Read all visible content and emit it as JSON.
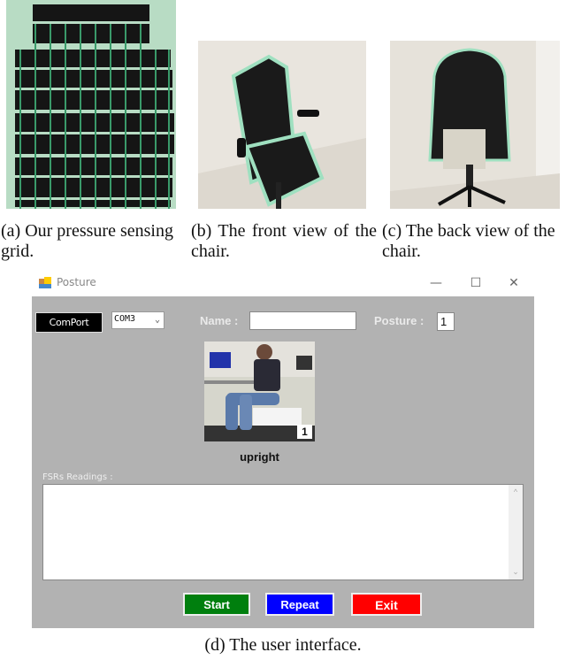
{
  "figures": {
    "a": {
      "caption": "(a) Our pressure sensing grid."
    },
    "b": {
      "caption": "(b) The front view of the chair."
    },
    "c": {
      "caption": "(c) The back view of the chair."
    },
    "d": {
      "caption": "(d) The user interface."
    }
  },
  "window": {
    "title": "Posture",
    "icon": "app-window-icon",
    "controls": {
      "minimize": "—",
      "maximize": "☐",
      "close": "✕"
    }
  },
  "toolbar": {
    "comport_label": "ComPort",
    "com_select_value": "COM3",
    "name_label": "Name :",
    "name_value": "",
    "posture_label": "Posture :",
    "posture_value": "1"
  },
  "posture_display": {
    "number": "1",
    "name": "upright"
  },
  "fsr": {
    "label": "FSRs Readings :",
    "value": ""
  },
  "buttons": {
    "start": "Start",
    "repeat": "Repeat",
    "exit": "Exit"
  },
  "colors": {
    "client_bg": "#b2b2b2",
    "start": "#007f0e",
    "repeat": "#0000ff",
    "exit": "#ff0000",
    "comport": "#000000"
  }
}
